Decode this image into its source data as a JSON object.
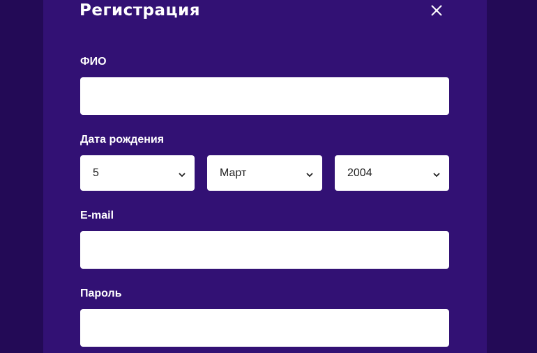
{
  "modal": {
    "title": "Регистрация",
    "close_icon": "close-icon"
  },
  "fields": {
    "fio": {
      "label": "ФИО",
      "value": "",
      "placeholder": ""
    },
    "birthdate": {
      "label": "Дата рождения",
      "day": "5",
      "month": "Март",
      "year": "2004"
    },
    "email": {
      "label": "E-mail",
      "value": "",
      "placeholder": ""
    },
    "password": {
      "label": "Пароль",
      "value": "",
      "placeholder": ""
    }
  },
  "colors": {
    "backdrop": "#230a56",
    "modal_bg": "#321174",
    "text": "#ffffff",
    "field_bg": "#ffffff"
  }
}
